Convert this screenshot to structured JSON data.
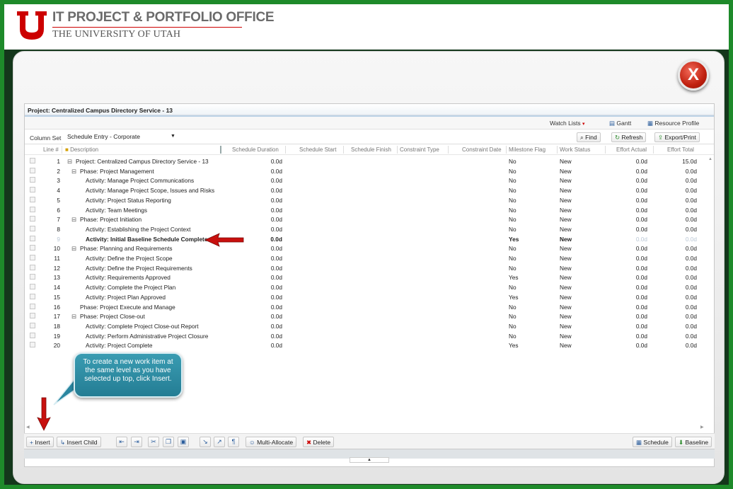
{
  "branding": {
    "title": "IT PROJECT & PORTFOLIO OFFICE",
    "subtitle": "THE UNIVERSITY OF UTAH",
    "logo_letter": "U",
    "accent_color": "#cc0000"
  },
  "modal": {
    "close_glyph": "X"
  },
  "app": {
    "title": "Project: Centralized Campus Directory Service - 13",
    "menu": {
      "watch_lists": "Watch Lists",
      "gantt": "Gantt",
      "resource_profile": "Resource Profile"
    },
    "toolbar": {
      "column_set_label": "Column Set",
      "column_set_value": "Schedule Entry - Corporate",
      "find": "Find",
      "refresh": "Refresh",
      "export_print": "Export/Print"
    },
    "columns": {
      "line": "Line #",
      "description": "Description",
      "schedule_duration": "Schedule Duration",
      "schedule_start": "Schedule Start",
      "schedule_finish": "Schedule Finish",
      "constraint_type": "Constraint Type",
      "constraint_date": "Constraint Date",
      "milestone_flag": "Milestone Flag",
      "work_status": "Work Status",
      "effort_actual": "Effort Actual",
      "effort_total": "Effort Total"
    },
    "rows": [
      {
        "line": "1",
        "toggle": "⊟",
        "desc": "Project: Centralized Campus Directory Service - 13",
        "level": 0,
        "duration": "0.0d",
        "milestone": "No",
        "status": "New",
        "actual": "0.0d",
        "total": "15.0d"
      },
      {
        "line": "2",
        "toggle": "⊟",
        "desc": "Phase: Project Management",
        "level": 1,
        "duration": "0.0d",
        "milestone": "No",
        "status": "New",
        "actual": "0.0d",
        "total": "0.0d"
      },
      {
        "line": "3",
        "toggle": "",
        "desc": "Activity: Manage Project Communications",
        "level": 2,
        "duration": "0.0d",
        "milestone": "No",
        "status": "New",
        "actual": "0.0d",
        "total": "0.0d"
      },
      {
        "line": "4",
        "toggle": "",
        "desc": "Activity: Manage Project Scope, Issues and Risks",
        "level": 2,
        "duration": "0.0d",
        "milestone": "No",
        "status": "New",
        "actual": "0.0d",
        "total": "0.0d"
      },
      {
        "line": "5",
        "toggle": "",
        "desc": "Activity: Project Status Reporting",
        "level": 2,
        "duration": "0.0d",
        "milestone": "No",
        "status": "New",
        "actual": "0.0d",
        "total": "0.0d"
      },
      {
        "line": "6",
        "toggle": "",
        "desc": "Activity: Team Meetings",
        "level": 2,
        "duration": "0.0d",
        "milestone": "No",
        "status": "New",
        "actual": "0.0d",
        "total": "0.0d"
      },
      {
        "line": "7",
        "toggle": "⊟",
        "desc": "Phase: Project Initiation",
        "level": 1,
        "duration": "0.0d",
        "milestone": "No",
        "status": "New",
        "actual": "0.0d",
        "total": "0.0d"
      },
      {
        "line": "8",
        "toggle": "",
        "desc": "Activity: Establishing the Project Context",
        "level": 2,
        "duration": "0.0d",
        "milestone": "No",
        "status": "New",
        "actual": "0.0d",
        "total": "0.0d"
      },
      {
        "line": "9",
        "toggle": "",
        "desc": "Activity: Initial Baseline Schedule Complete",
        "level": 2,
        "duration": "0.0d",
        "milestone": "Yes",
        "status": "New",
        "actual": "0.0d",
        "total": "0.0d",
        "selected": true
      },
      {
        "line": "10",
        "toggle": "⊟",
        "desc": "Phase: Planning and Requirements",
        "level": 1,
        "duration": "0.0d",
        "milestone": "No",
        "status": "New",
        "actual": "0.0d",
        "total": "0.0d"
      },
      {
        "line": "11",
        "toggle": "",
        "desc": "Activity: Define the Project Scope",
        "level": 2,
        "duration": "0.0d",
        "milestone": "No",
        "status": "New",
        "actual": "0.0d",
        "total": "0.0d"
      },
      {
        "line": "12",
        "toggle": "",
        "desc": "Activity: Define the Project Requirements",
        "level": 2,
        "duration": "0.0d",
        "milestone": "No",
        "status": "New",
        "actual": "0.0d",
        "total": "0.0d"
      },
      {
        "line": "13",
        "toggle": "",
        "desc": "Activity: Requirements Approved",
        "level": 2,
        "duration": "0.0d",
        "milestone": "Yes",
        "status": "New",
        "actual": "0.0d",
        "total": "0.0d"
      },
      {
        "line": "14",
        "toggle": "",
        "desc": "Activity: Complete the Project Plan",
        "level": 2,
        "duration": "0.0d",
        "milestone": "No",
        "status": "New",
        "actual": "0.0d",
        "total": "0.0d"
      },
      {
        "line": "15",
        "toggle": "",
        "desc": "Activity: Project Plan Approved",
        "level": 2,
        "duration": "0.0d",
        "milestone": "Yes",
        "status": "New",
        "actual": "0.0d",
        "total": "0.0d"
      },
      {
        "line": "16",
        "toggle": "",
        "desc": "Phase: Project Execute and Manage",
        "level": 1,
        "duration": "0.0d",
        "milestone": "No",
        "status": "New",
        "actual": "0.0d",
        "total": "0.0d"
      },
      {
        "line": "17",
        "toggle": "⊟",
        "desc": "Phase: Project Close-out",
        "level": 1,
        "duration": "0.0d",
        "milestone": "No",
        "status": "New",
        "actual": "0.0d",
        "total": "0.0d"
      },
      {
        "line": "18",
        "toggle": "",
        "desc": "Activity: Complete Project Close-out Report",
        "level": 2,
        "duration": "0.0d",
        "milestone": "No",
        "status": "New",
        "actual": "0.0d",
        "total": "0.0d"
      },
      {
        "line": "19",
        "toggle": "",
        "desc": "Activity: Perform Administrative Project Closure",
        "level": 2,
        "duration": "0.0d",
        "milestone": "No",
        "status": "New",
        "actual": "0.0d",
        "total": "0.0d"
      },
      {
        "line": "20",
        "toggle": "",
        "desc": "Activity: Project Complete",
        "level": 2,
        "duration": "0.0d",
        "milestone": "Yes",
        "status": "New",
        "actual": "0.0d",
        "total": "0.0d"
      }
    ],
    "bottom_toolbar": {
      "insert": "Insert",
      "insert_child": "Insert Child",
      "multi_allocate": "Multi-Allocate",
      "delete": "Delete",
      "schedule": "Schedule",
      "baseline": "Baseline"
    }
  },
  "callout": {
    "text": "To create a new work item at the same level as you have selected up top, click Insert."
  }
}
